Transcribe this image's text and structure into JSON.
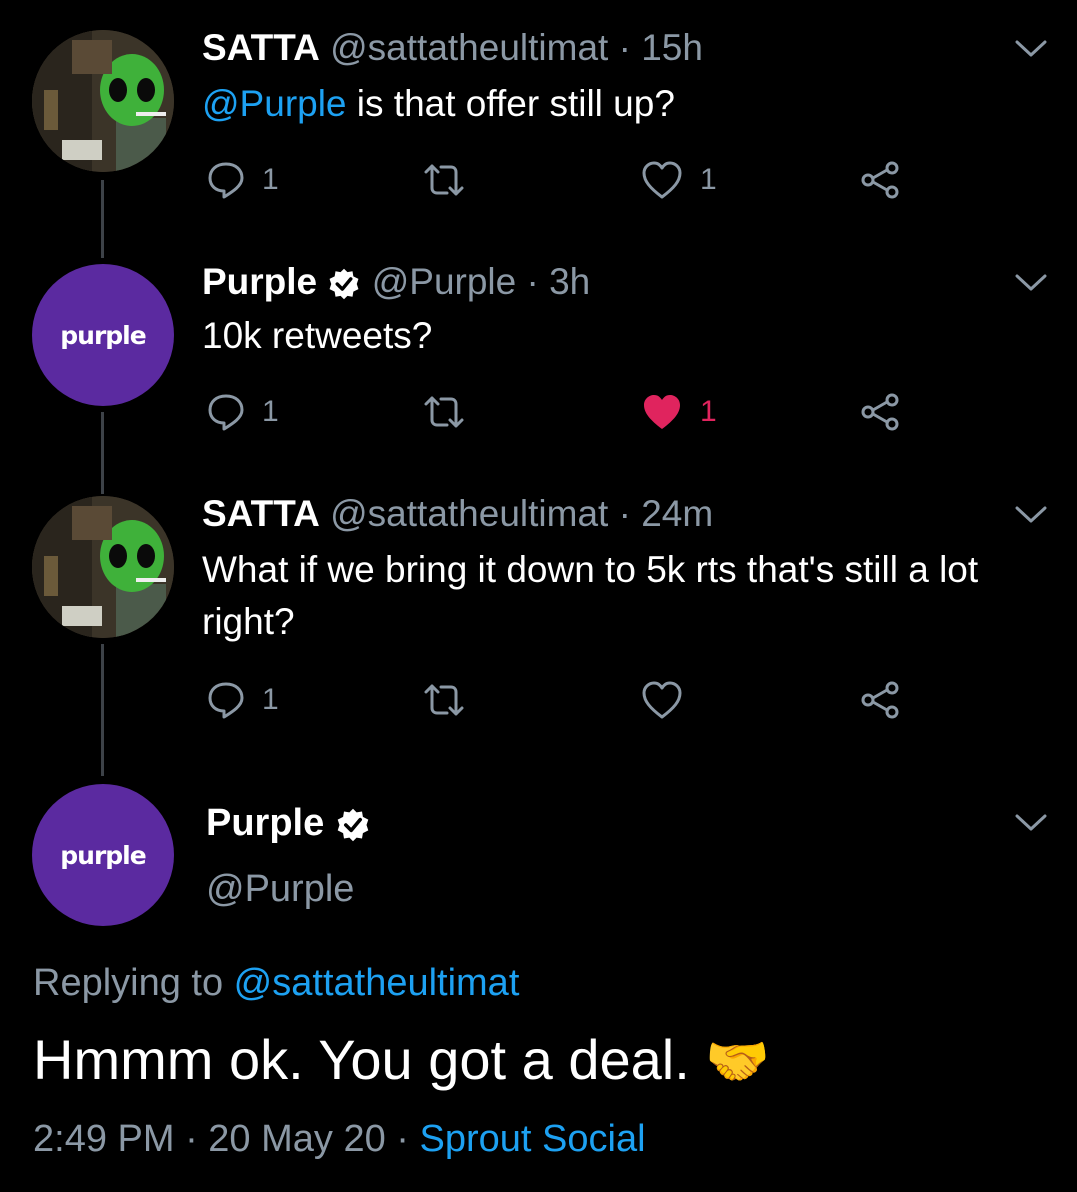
{
  "tweets": [
    {
      "name": "SATTA",
      "handle_time": "@sattatheultimat · 15h",
      "mention": "@Purple",
      "text": " is that offer still up?",
      "replies": "1",
      "likes": "1",
      "liked": false
    },
    {
      "name": "Purple",
      "handle_time": "@Purple · 3h",
      "text": "10k retweets?",
      "replies": "1",
      "likes": "1",
      "liked": true
    },
    {
      "name": "SATTA",
      "handle_time": "@sattatheultimat · 24m",
      "text": "What if we bring it down to 5k rts that's still a lot right?",
      "replies": "1",
      "likes": "",
      "liked": false
    }
  ],
  "main_tweet": {
    "name": "Purple",
    "handle": "@Purple",
    "avatar_text": "purple",
    "replying_prefix": "Replying to ",
    "replying_handle": "@sattatheultimat",
    "text": "Hmmm ok. You got a deal.",
    "emoji": "🤝",
    "time_date": "2:49 PM · 20 May 20 · ",
    "source": "Sprout Social"
  },
  "colors": {
    "background": "#000000",
    "link": "#1da1f2",
    "muted": "#8b98a5",
    "like_active": "#e0245e",
    "purple_brand": "#5b2aa0"
  },
  "icons": [
    "reply-icon",
    "retweet-icon",
    "like-icon",
    "share-icon",
    "chevron-down-icon",
    "verified-badge-icon"
  ]
}
